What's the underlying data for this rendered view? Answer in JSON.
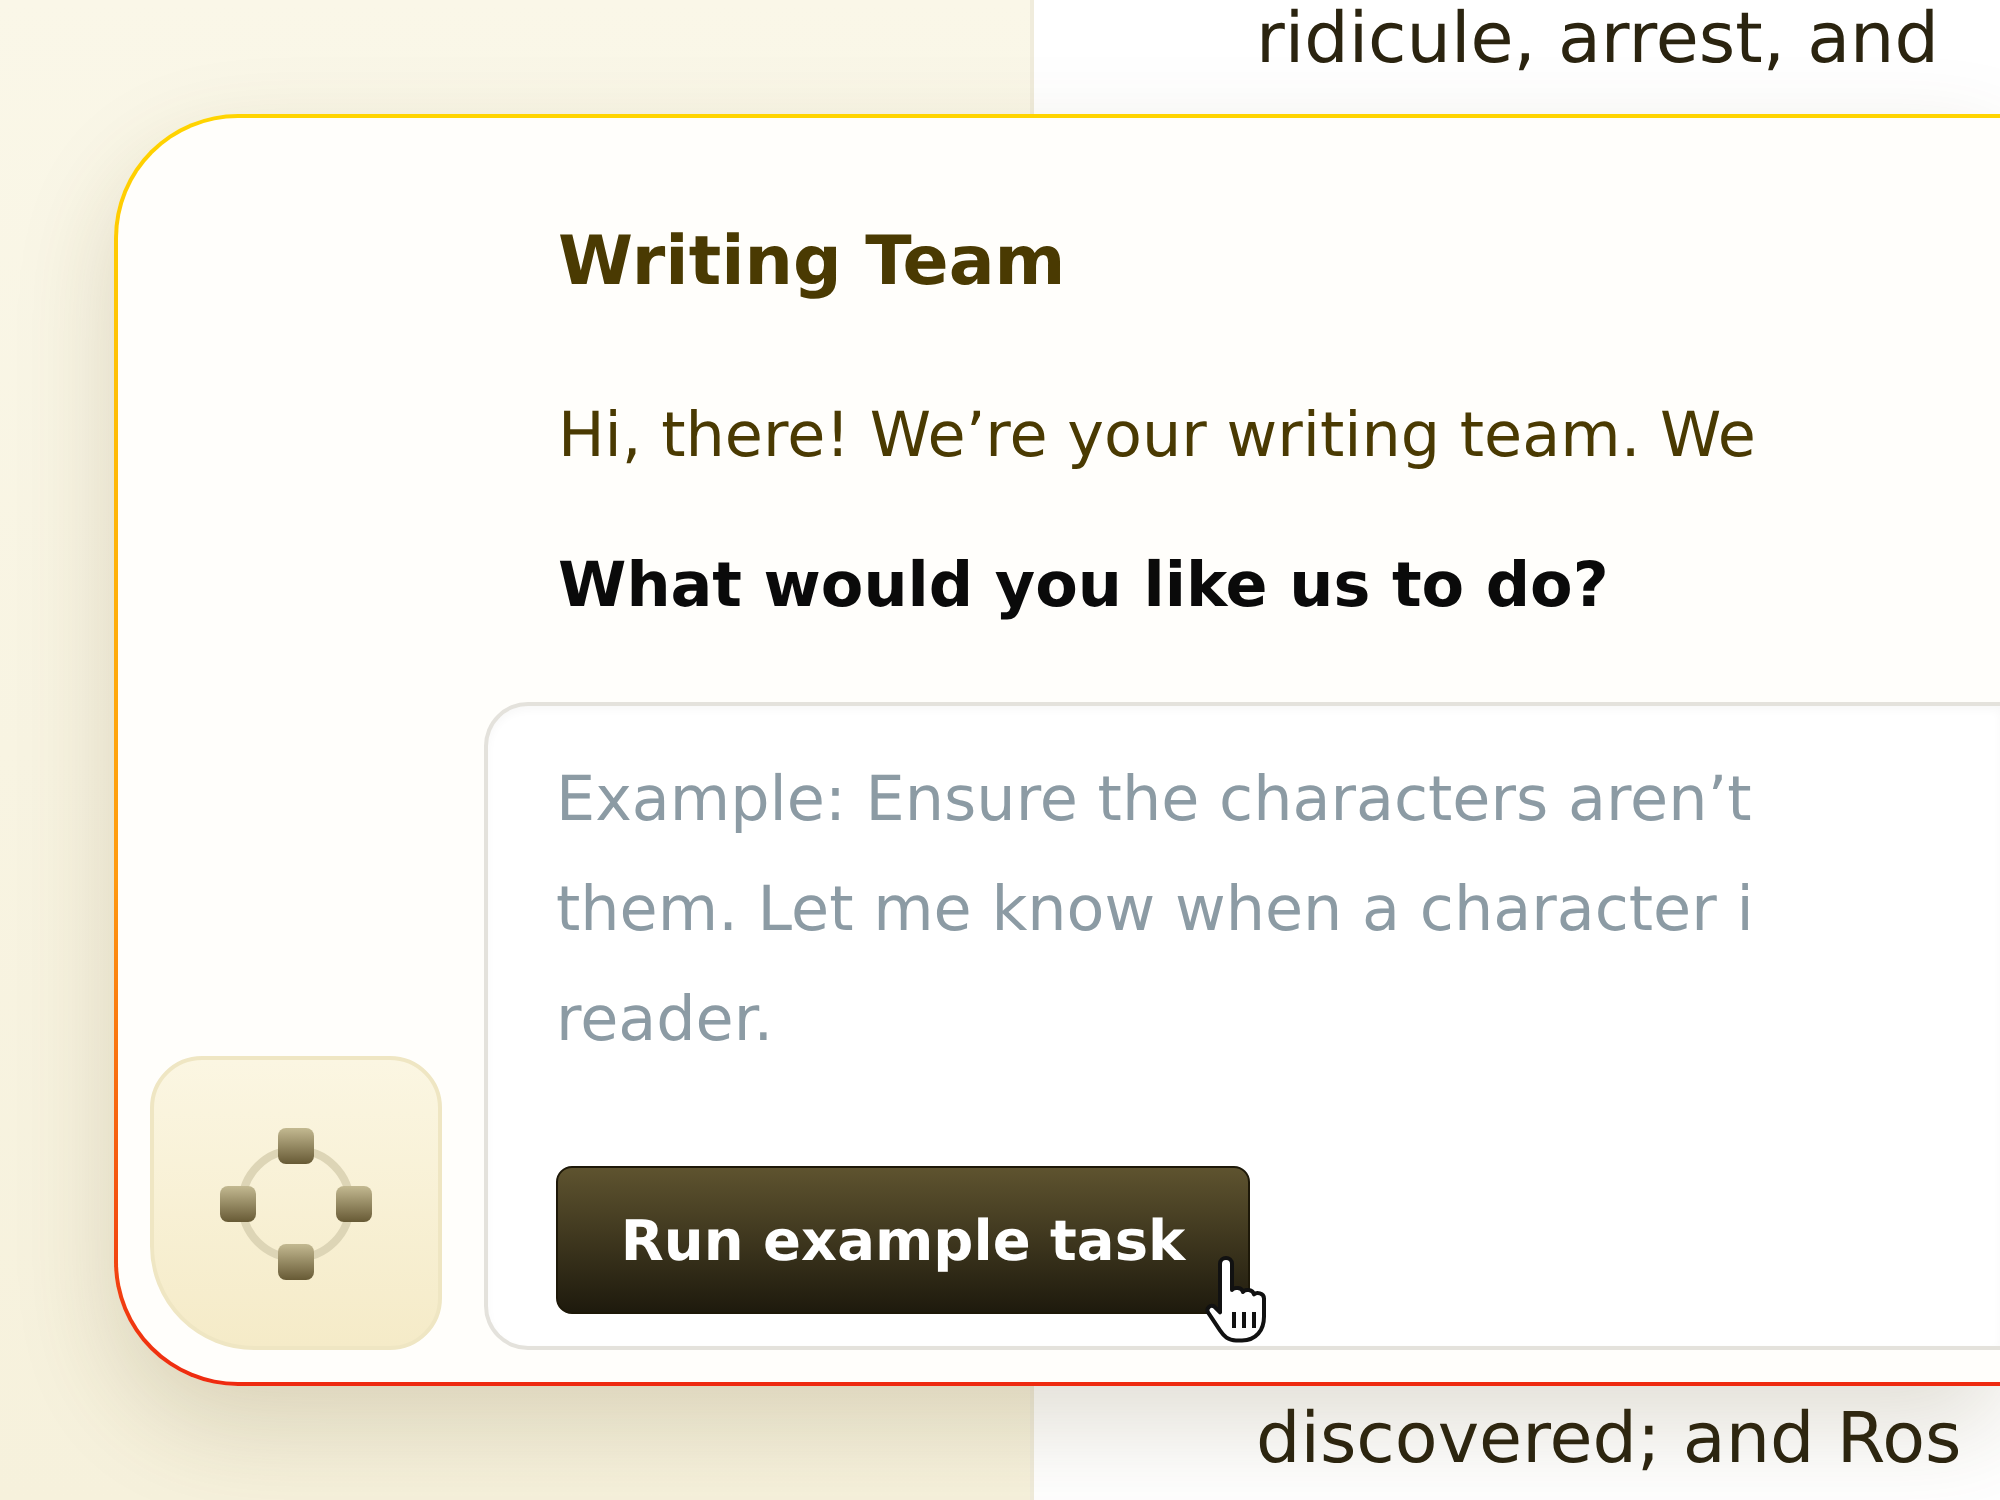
{
  "document": {
    "top_line": "ridicule, arrest, and",
    "bottom_line": "discovered; and Ros"
  },
  "panel": {
    "title": "Writing Team",
    "greeting": "Hi, there! We’re your writing team. We",
    "question": "What would you like us to do?",
    "task_field": {
      "placeholder": "Example: Ensure the characters aren’t\nthem. Let me know when a character i\nreader."
    },
    "run_button": {
      "label": "Run example task"
    }
  }
}
